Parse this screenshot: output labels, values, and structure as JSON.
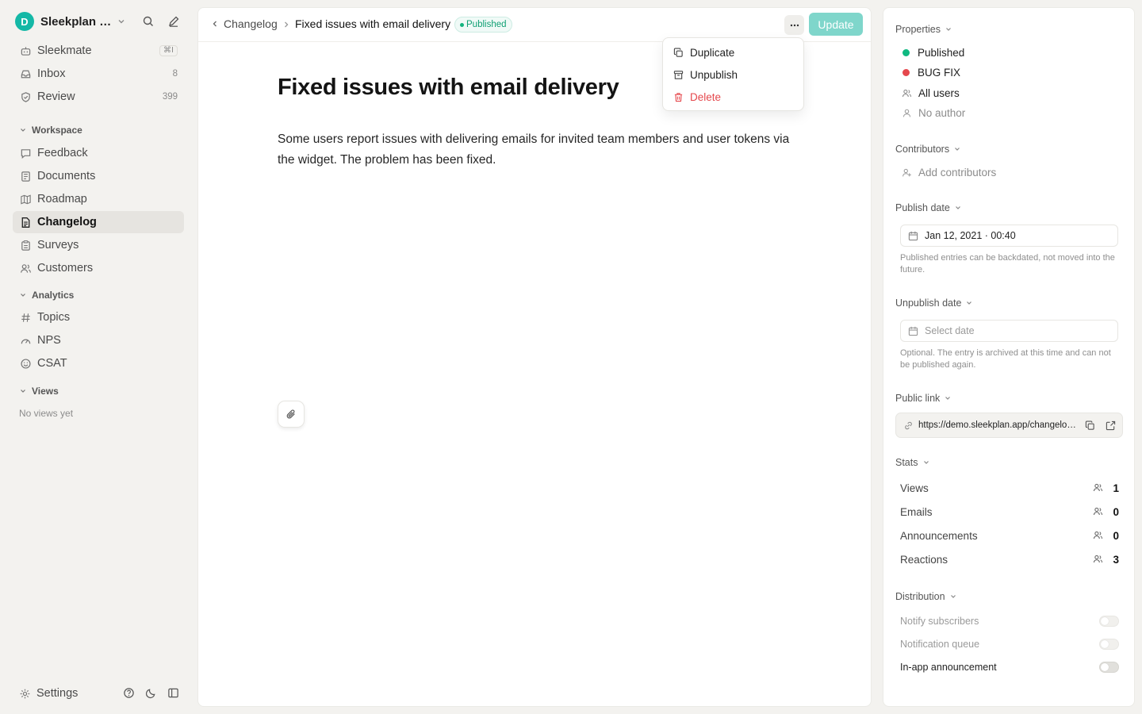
{
  "workspace": {
    "initial": "D",
    "name": "Sleekplan (Demo)"
  },
  "nav_top": [
    {
      "label": "Sleekmate",
      "kbd": "⌘I"
    },
    {
      "label": "Inbox",
      "count": "8"
    },
    {
      "label": "Review",
      "count": "399"
    }
  ],
  "sections": {
    "workspace": "Workspace",
    "analytics": "Analytics",
    "views": "Views"
  },
  "nav_workspace": [
    {
      "label": "Feedback"
    },
    {
      "label": "Documents"
    },
    {
      "label": "Roadmap"
    },
    {
      "label": "Changelog"
    },
    {
      "label": "Surveys"
    },
    {
      "label": "Customers"
    }
  ],
  "nav_analytics": [
    {
      "label": "Topics"
    },
    {
      "label": "NPS"
    },
    {
      "label": "CSAT"
    }
  ],
  "views_empty": "No views yet",
  "settings_label": "Settings",
  "breadcrumb": {
    "back": "Changelog",
    "title": "Fixed issues with email delivery"
  },
  "status_badge": "Published",
  "update_label": "Update",
  "menu": {
    "duplicate": "Duplicate",
    "unpublish": "Unpublish",
    "delete": "Delete"
  },
  "document": {
    "title": "Fixed issues with email delivery",
    "body": "Some users report issues with delivering emails for invited team members and user tokens via the widget. The problem has been fixed."
  },
  "panel": {
    "properties_label": "Properties",
    "status": "Published",
    "status_color": "#10b981",
    "type": "BUG FIX",
    "type_color": "#e5484d",
    "audience": "All users",
    "author": "No author",
    "contributors_label": "Contributors",
    "add_contributors": "Add contributors",
    "publish_date_label": "Publish date",
    "publish_date": "Jan 12, 2021 · 00:40",
    "publish_hint": "Published entries can be backdated, not moved into the future.",
    "unpublish_date_label": "Unpublish date",
    "unpublish_placeholder": "Select date",
    "unpublish_hint": "Optional. The entry is archived at this time and can not be published again.",
    "public_link_label": "Public link",
    "public_link": "https://demo.sleekplan.app/changelog/...",
    "stats_label": "Stats",
    "stats": [
      {
        "label": "Views",
        "value": "1"
      },
      {
        "label": "Emails",
        "value": "0"
      },
      {
        "label": "Announcements",
        "value": "0"
      },
      {
        "label": "Reactions",
        "value": "3"
      }
    ],
    "distribution_label": "Distribution",
    "distribution": [
      {
        "label": "Notify subscribers",
        "enabled": false
      },
      {
        "label": "Notification queue",
        "enabled": false
      },
      {
        "label": "In-app announcement",
        "enabled": true
      }
    ]
  }
}
